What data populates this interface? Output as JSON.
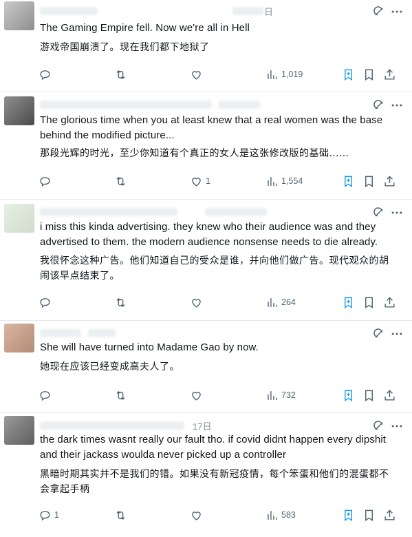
{
  "posts": [
    {
      "en": "The Gaming Empire fell. Now we're all in Hell",
      "zh": "游戏帝国崩溃了。现在我们都下地狱了",
      "date_fragment": "日",
      "replies": "",
      "likes": "",
      "views": "1,019"
    },
    {
      "en": "The glorious time when you at least knew that a real women was the base behind the modified picture...",
      "zh": "那段光辉的时光，至少你知道有个真正的女人是这张修改版的基础……",
      "date_fragment": "",
      "replies": "",
      "likes": "1",
      "views": "1,554"
    },
    {
      "en": "i miss this kinda advertising. they knew who their audience was and they advertised to them. the modern audience nonsense needs to die already.",
      "zh": "我很怀念这种广告。他们知道自己的受众是谁，并向他们做广告。现代观众的胡闹该早点结束了。",
      "date_fragment": "",
      "replies": "",
      "likes": "",
      "views": "264"
    },
    {
      "en": "She will have turned into Madame Gao by now.",
      "zh": "她现在应该已经变成高夫人了。",
      "date_fragment": "",
      "replies": "",
      "likes": "",
      "views": "732"
    },
    {
      "en": "the dark times wasnt really our fault tho. if covid didnt happen every dipshit and their jackass woulda never picked up a controller",
      "zh": "黑暗时期其实并不是我们的错。如果没有新冠疫情，每个笨蛋和他们的混蛋都不会拿起手柄",
      "date_fragment": "17日",
      "replies": "1",
      "likes": "",
      "views": "583"
    }
  ],
  "colors": {
    "text": "#0f1419",
    "secondary": "#536471",
    "accent": "#1d9bf0",
    "divider": "#e6e9ec"
  },
  "icons": [
    "grok-icon",
    "more-icon",
    "reply-icon",
    "retweet-icon",
    "like-icon",
    "views-icon",
    "grok-summary-icon",
    "bookmark-icon",
    "share-icon"
  ]
}
